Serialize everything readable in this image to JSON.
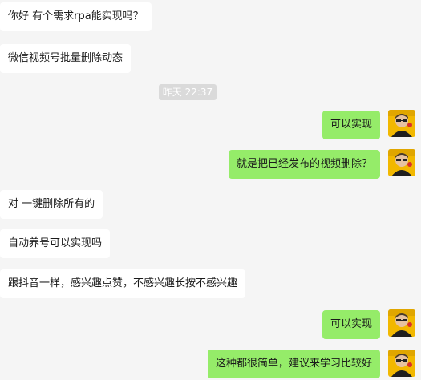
{
  "chat": {
    "timestamp": "昨天 22:37",
    "messages": [
      {
        "side": "left",
        "text": "你好 有个需求rpa能实现吗？"
      },
      {
        "side": "left",
        "text": "微信视频号批量删除动态"
      },
      {
        "side": "right",
        "text": "可以实现"
      },
      {
        "side": "right",
        "text": "就是把已经发布的视频删除？"
      },
      {
        "side": "left",
        "text": "对 一键删除所有的"
      },
      {
        "side": "left",
        "text": "自动养号可以实现吗"
      },
      {
        "side": "left",
        "text": "跟抖音一样，感兴趣点赞，不感兴趣长按不感兴趣"
      },
      {
        "side": "right",
        "text": "可以实现"
      },
      {
        "side": "right",
        "text": "这种都很简单，建议来学习比较好"
      }
    ]
  },
  "colors": {
    "background": "#f5f5f5",
    "incoming_bubble": "#ffffff",
    "outgoing_bubble": "#95ec69",
    "timestamp_pill": "#dadada",
    "avatar_bg": "#f2b800"
  },
  "avatar_icon": "user-avatar-photo"
}
